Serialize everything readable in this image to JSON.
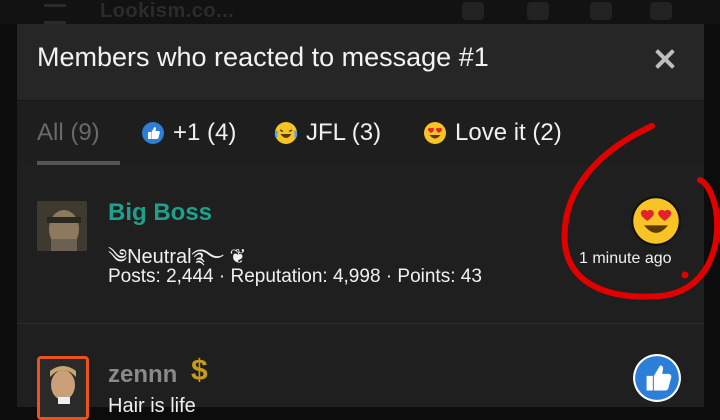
{
  "background": {
    "logo": "Lookism.co..."
  },
  "modal": {
    "title": "Members who reacted to message #1",
    "tabs": [
      {
        "label": "All (9)",
        "icon": ""
      },
      {
        "label": "+1 (4)",
        "icon": "thumbs-up-icon"
      },
      {
        "label": "JFL (3)",
        "icon": "laughing-crying-icon"
      },
      {
        "label": "Love it (2)",
        "icon": "heart-eyes-icon"
      }
    ],
    "members": [
      {
        "name": "Big Boss",
        "name_color": "#1fa08c",
        "title": "Neutral",
        "stats": "Posts: 2,444 · Reputation: 4,998 · Points: 43",
        "reaction_icon": "heart-eyes-icon",
        "time": "1 minute ago"
      },
      {
        "name": "zennn",
        "name_color": "#8a8a8a",
        "badge": "$",
        "title": "Hair is life",
        "reaction_icon": "thumbs-up-icon"
      }
    ]
  },
  "colors": {
    "annotation_red": "#e00000",
    "accent_blue": "#2b7fd8",
    "modal_bg": "#262626"
  }
}
